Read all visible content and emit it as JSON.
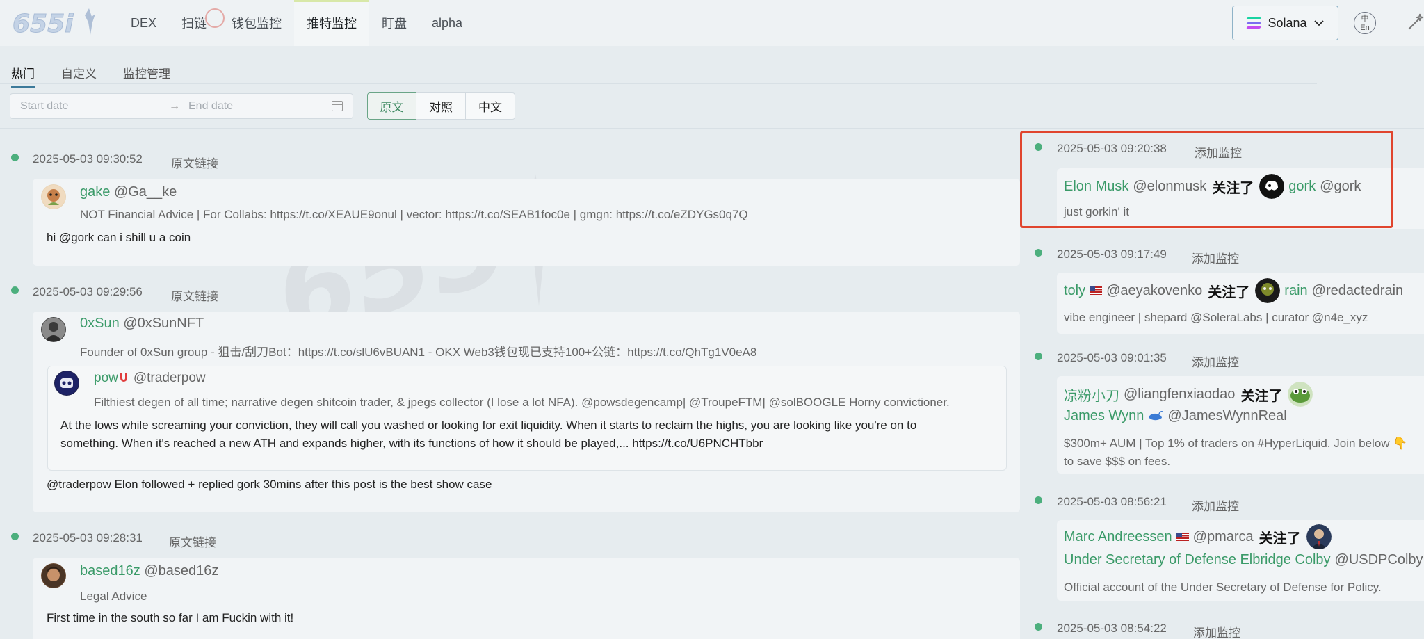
{
  "brand": {
    "logo_text": "655i"
  },
  "nav": {
    "items": [
      {
        "label": "DEX"
      },
      {
        "label": "扫链"
      },
      {
        "label": "钱包监控"
      },
      {
        "label": "推特监控"
      },
      {
        "label": "盯盘"
      },
      {
        "label": "alpha"
      }
    ],
    "active_index": 3
  },
  "chain_selector": {
    "label": "Solana"
  },
  "lang_toggle": {
    "top": "中",
    "bottom": "En"
  },
  "subtabs": [
    {
      "label": "热门"
    },
    {
      "label": "自定义"
    },
    {
      "label": "监控管理"
    }
  ],
  "filters": {
    "start_placeholder": "Start date",
    "end_placeholder": "End date",
    "arrow": "→",
    "modes": [
      {
        "label": "原文"
      },
      {
        "label": "对照"
      },
      {
        "label": "中文"
      }
    ],
    "active_mode": 0
  },
  "feed": [
    {
      "time": "2025-05-03 09:30:52",
      "link_label": "原文链接",
      "name": "gake",
      "handle": "@Ga__ke",
      "bio": "NOT Financial Advice | For Collabs: https://t.co/XEAUE9onul | vector: https://t.co/SEAB1foc0e | gmgn: https://t.co/eZDYGs0q7Q",
      "text": "hi @gork can i shill u a coin"
    },
    {
      "time": "2025-05-03 09:29:56",
      "link_label": "原文链接",
      "name": "0xSun",
      "handle": "@0xSunNFT",
      "bio": "Founder of 0xSun group - 狙击/刮刀Bot：https://t.co/slU6vBUAN1 - OKX Web3钱包现已支持100+公链：https://t.co/QhTg1V0eA8",
      "quote": {
        "name": "pow",
        "handle": "@traderpow",
        "bio": "Filthiest degen of all time; narrative degen shitcoin trader, & jpegs collector (I lose a lot NFA). @powsdegencamp| @TroupeFTM| @solBOOGLE Horny convictioner.",
        "text_line1": "At the lows while screaming your conviction, they will call you washed or looking for exit liquidity. When it starts to reclaim the highs, you are looking like you're on to",
        "text_line2": "something. When it's reached a new ATH and expands higher, with its functions of how it should be played,... https://t.co/U6PNCHTbbr"
      },
      "text": "@traderpow Elon followed + replied gork 30mins after this post is the best show case"
    },
    {
      "time": "2025-05-03 09:28:31",
      "link_label": "原文链接",
      "name": "based16z",
      "handle": "@based16z",
      "bio": "Legal Advice",
      "text": "First time in the south so far I am Fuckin with it!"
    }
  ],
  "follow_verb": "关注了",
  "add_monitor_label": "添加监控",
  "follows": [
    {
      "time": "2025-05-03 09:20:38",
      "follower_name": "Elon Musk",
      "follower_handle": "@elonmusk",
      "target_name": "gork",
      "target_handle": "@gork",
      "bio": "just gorkin' it"
    },
    {
      "time": "2025-05-03 09:17:49",
      "follower_name": "toly",
      "follower_handle": "@aeyakovenko",
      "target_name": "rain",
      "target_handle": "@redactedrain",
      "bio": "vibe engineer | shepard @SoleraLabs | curator @n4e_xyz"
    },
    {
      "time": "2025-05-03 09:01:35",
      "follower_name": "凉粉小刀",
      "follower_handle": "@liangfenxiaodao",
      "target_name": "James Wynn",
      "target_handle": "@JamesWynnReal",
      "bio_line1": "$300m+ AUM | Top 1% of traders on #HyperLiquid. Join below 👇",
      "bio_line2": "to save $$$ on fees."
    },
    {
      "time": "2025-05-03 08:56:21",
      "follower_name": "Marc Andreessen",
      "follower_handle": "@pmarca",
      "target_name": "Under Secretary of Defense Elbridge Colby",
      "target_handle": "@USDPColby",
      "bio": "Official account of the Under Secretary of Defense for Policy."
    },
    {
      "time": "2025-05-03 08:54:22"
    }
  ],
  "colors": {
    "accent_green": "#3a9a68",
    "dot_green": "#4caf7d",
    "highlight_red": "#e0452e"
  }
}
